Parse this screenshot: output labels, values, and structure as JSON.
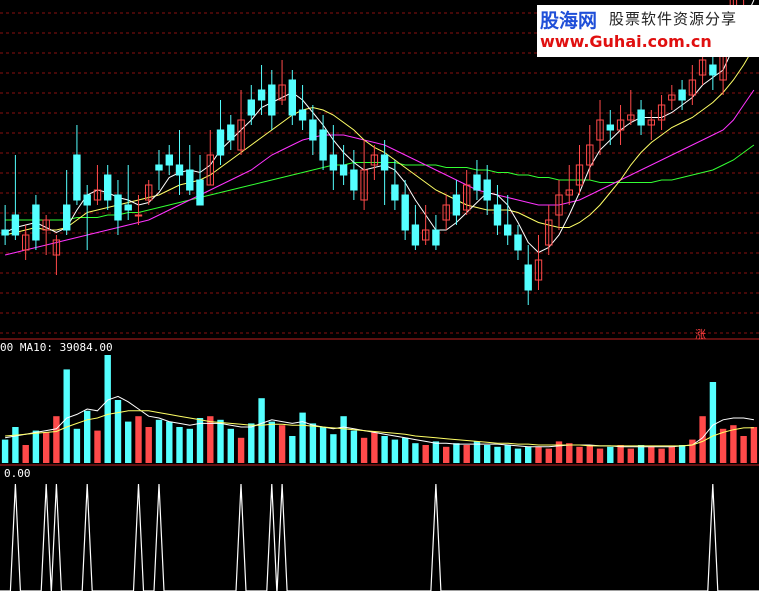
{
  "watermark": {
    "logo": "股海网",
    "tagline": "股票软件资源分享",
    "url": "www.Guhai.com.cn"
  },
  "badge": "涨",
  "volume_label_prefix": "00",
  "volume_label": "MA10: 39084.00",
  "signal_label": "0.00",
  "colors": {
    "background": "#000000",
    "up": "#ff4a4a",
    "down": "#54ffff",
    "grid": "#8a1010",
    "ma5": "#ffffff",
    "ma10": "#ffff66",
    "ma20": "#ff33ff",
    "ma60": "#33ff33",
    "separator": "#c02020",
    "signal": "#ffffff"
  },
  "chart_data": [
    {
      "type": "candlestick",
      "panel": "price",
      "ylim": [
        0,
        100
      ],
      "series": [
        {
          "name": "candles",
          "values": [
            [
              30,
              28,
              40,
              24
            ],
            [
              36,
              28,
              60,
              26
            ],
            [
              22,
              28,
              32,
              18
            ],
            [
              40,
              26,
              44,
              22
            ],
            [
              30,
              34,
              36,
              20
            ],
            [
              20,
              26,
              28,
              12
            ],
            [
              40,
              30,
              54,
              28
            ],
            [
              60,
              42,
              72,
              40
            ],
            [
              44,
              40,
              48,
              22
            ],
            [
              42,
              46,
              56,
              40
            ],
            [
              52,
              42,
              56,
              38
            ],
            [
              44,
              34,
              50,
              28
            ],
            [
              40,
              38,
              56,
              34
            ],
            [
              36,
              36,
              44,
              32
            ],
            [
              42,
              48,
              50,
              40
            ],
            [
              56,
              54,
              62,
              46
            ],
            [
              60,
              56,
              64,
              52
            ],
            [
              56,
              52,
              70,
              44
            ],
            [
              54,
              46,
              64,
              44
            ],
            [
              50,
              40,
              60,
              40
            ],
            [
              48,
              60,
              70,
              48
            ],
            [
              70,
              60,
              82,
              56
            ],
            [
              72,
              66,
              76,
              62
            ],
            [
              62,
              74,
              86,
              60
            ],
            [
              82,
              76,
              88,
              72
            ],
            [
              86,
              82,
              96,
              76
            ],
            [
              88,
              76,
              94,
              70
            ],
            [
              82,
              88,
              98,
              80
            ],
            [
              90,
              76,
              94,
              72
            ],
            [
              78,
              74,
              88,
              70
            ],
            [
              74,
              66,
              80,
              60
            ],
            [
              70,
              58,
              76,
              54
            ],
            [
              60,
              54,
              72,
              46
            ],
            [
              56,
              52,
              64,
              48
            ],
            [
              54,
              46,
              62,
              42
            ],
            [
              42,
              54,
              66,
              38
            ],
            [
              56,
              60,
              64,
              50
            ],
            [
              60,
              54,
              66,
              40
            ],
            [
              48,
              42,
              58,
              38
            ],
            [
              44,
              30,
              50,
              26
            ],
            [
              32,
              24,
              40,
              22
            ],
            [
              26,
              30,
              40,
              24
            ],
            [
              30,
              24,
              36,
              22
            ],
            [
              34,
              40,
              44,
              30
            ],
            [
              44,
              36,
              50,
              32
            ],
            [
              38,
              48,
              54,
              36
            ],
            [
              52,
              46,
              58,
              42
            ],
            [
              50,
              42,
              56,
              36
            ],
            [
              40,
              32,
              48,
              28
            ],
            [
              32,
              28,
              44,
              24
            ],
            [
              28,
              22,
              32,
              18
            ],
            [
              16,
              6,
              24,
              0
            ],
            [
              10,
              18,
              28,
              6
            ],
            [
              24,
              34,
              40,
              20
            ],
            [
              36,
              44,
              50,
              30
            ],
            [
              44,
              46,
              56,
              40
            ],
            [
              48,
              56,
              64,
              44
            ],
            [
              56,
              64,
              72,
              50
            ],
            [
              66,
              74,
              82,
              60
            ],
            [
              72,
              70,
              78,
              64
            ],
            [
              70,
              74,
              80,
              64
            ],
            [
              74,
              76,
              86,
              72
            ],
            [
              78,
              72,
              82,
              68
            ],
            [
              72,
              74,
              78,
              66
            ],
            [
              74,
              80,
              84,
              70
            ],
            [
              82,
              84,
              88,
              78
            ],
            [
              86,
              82,
              90,
              78
            ],
            [
              84,
              90,
              96,
              80
            ],
            [
              92,
              98,
              104,
              88
            ],
            [
              96,
              92,
              102,
              86
            ],
            [
              90,
              108,
              116,
              84
            ],
            [
              112,
              124,
              132,
              108
            ],
            [
              126,
              130,
              140,
              120
            ],
            [
              132,
              138,
              146,
              128
            ]
          ]
        },
        {
          "name": "MA5",
          "values": [
            29,
            31,
            32,
            33,
            31,
            29,
            31,
            38,
            44,
            46,
            45,
            43,
            42,
            40,
            41,
            45,
            51,
            53,
            54,
            53,
            56,
            62,
            66,
            70,
            74,
            79,
            81,
            83,
            85,
            82,
            77,
            72,
            66,
            61,
            57,
            54,
            55,
            56,
            54,
            49,
            42,
            36,
            30,
            30,
            33,
            37,
            41,
            45,
            44,
            40,
            33,
            25,
            21,
            23,
            28,
            36,
            45,
            55,
            62,
            66,
            70,
            73,
            75,
            75,
            75,
            77,
            80,
            83,
            88,
            91,
            94,
            103,
            113,
            122
          ]
        },
        {
          "name": "MA10",
          "values": [
            28,
            29,
            30,
            31,
            30,
            30,
            31,
            34,
            37,
            38,
            39,
            40,
            41,
            42,
            43,
            44,
            46,
            48,
            49,
            50,
            52,
            55,
            58,
            61,
            64,
            67,
            70,
            73,
            76,
            78,
            79,
            78,
            76,
            73,
            70,
            66,
            63,
            61,
            58,
            55,
            52,
            49,
            46,
            44,
            42,
            40,
            39,
            38,
            38,
            38,
            37,
            35,
            33,
            32,
            31,
            31,
            33,
            36,
            40,
            45,
            50,
            56,
            61,
            65,
            68,
            71,
            73,
            75,
            78,
            81,
            85,
            90,
            96,
            103
          ]
        },
        {
          "name": "MA20",
          "values": [
            20,
            21,
            22,
            23,
            24,
            25,
            26,
            27,
            28,
            29,
            30,
            31,
            32,
            33,
            34,
            36,
            38,
            40,
            42,
            44,
            46,
            48,
            50,
            52,
            54,
            57,
            60,
            62,
            64,
            66,
            67,
            68,
            68,
            68,
            67,
            66,
            65,
            64,
            62,
            60,
            58,
            56,
            54,
            52,
            50,
            48,
            46,
            45,
            44,
            43,
            42,
            41,
            40,
            40,
            40,
            41,
            42,
            44,
            46,
            48,
            50,
            52,
            54,
            56,
            58,
            60,
            62,
            64,
            66,
            68,
            70,
            74,
            80,
            86
          ]
        },
        {
          "name": "MA60",
          "values": [
            34,
            34,
            34,
            34,
            34,
            34,
            34,
            35,
            35,
            35,
            36,
            36,
            37,
            37,
            38,
            39,
            40,
            41,
            42,
            43,
            44,
            45,
            46,
            47,
            48,
            49,
            50,
            51,
            52,
            53,
            54,
            55,
            56,
            56,
            57,
            57,
            57,
            57,
            57,
            56,
            56,
            56,
            56,
            55,
            55,
            55,
            54,
            54,
            53,
            53,
            52,
            52,
            51,
            51,
            50,
            50,
            50,
            50,
            49,
            49,
            49,
            49,
            49,
            49,
            50,
            50,
            51,
            52,
            53,
            54,
            56,
            58,
            61,
            64
          ]
        }
      ]
    },
    {
      "type": "bar",
      "panel": "volume",
      "ylim": [
        0,
        120000
      ],
      "series": [
        {
          "name": "volume",
          "values": [
            26000,
            40000,
            20000,
            36000,
            34000,
            52000,
            104000,
            38000,
            58000,
            36000,
            120000,
            70000,
            46000,
            52000,
            40000,
            48000,
            46000,
            40000,
            38000,
            50000,
            52000,
            48000,
            38000,
            28000,
            44000,
            72000,
            46000,
            42000,
            30000,
            56000,
            44000,
            40000,
            32000,
            52000,
            36000,
            28000,
            34000,
            30000,
            26000,
            28000,
            22000,
            20000,
            24000,
            18000,
            22000,
            20000,
            24000,
            20000,
            18000,
            20000,
            16000,
            18000,
            18000,
            16000,
            24000,
            22000,
            18000,
            20000,
            16000,
            18000,
            20000,
            16000,
            20000,
            18000,
            16000,
            18000,
            20000,
            26000,
            52000,
            90000,
            38000,
            42000,
            30000,
            40000
          ]
        },
        {
          "name": "MA5",
          "values": [
            28000,
            30000,
            32000,
            34000,
            36000,
            38000,
            50000,
            54000,
            60000,
            58000,
            70000,
            74000,
            68000,
            60000,
            52000,
            50000,
            46000,
            44000,
            42000,
            44000,
            44000,
            44000,
            42000,
            40000,
            40000,
            44000,
            48000,
            46000,
            44000,
            46000,
            42000,
            40000,
            38000,
            40000,
            38000,
            36000,
            34000,
            32000,
            30000,
            28000,
            26000,
            24000,
            22000,
            22000,
            21000,
            21000,
            21000,
            21000,
            21000,
            20000,
            19000,
            18000,
            18000,
            18000,
            19000,
            20000,
            20000,
            20000,
            19000,
            19000,
            18000,
            18000,
            18000,
            18000,
            18000,
            18000,
            19000,
            20000,
            28000,
            42000,
            48000,
            50000,
            50000,
            48000
          ]
        },
        {
          "name": "MA10",
          "values": [
            30000,
            31000,
            32000,
            33000,
            34000,
            35000,
            40000,
            44000,
            48000,
            50000,
            54000,
            56000,
            58000,
            58000,
            58000,
            56000,
            54000,
            52000,
            50000,
            48000,
            46000,
            45000,
            44000,
            43000,
            42000,
            42000,
            43000,
            43000,
            42000,
            42000,
            41000,
            40000,
            39000,
            38000,
            37000,
            36000,
            35000,
            34000,
            33000,
            32000,
            30000,
            29000,
            28000,
            27000,
            26000,
            25000,
            24000,
            23000,
            22000,
            22000,
            21000,
            21000,
            20000,
            20000,
            20000,
            20000,
            20000,
            19000,
            19000,
            19000,
            19000,
            19000,
            19000,
            19000,
            19000,
            19000,
            19000,
            20000,
            24000,
            30000,
            34000,
            37000,
            39000,
            39084
          ]
        }
      ]
    },
    {
      "type": "line",
      "panel": "signal",
      "ylim": [
        0,
        1
      ],
      "series": [
        {
          "name": "signal",
          "values": [
            0,
            1,
            0,
            0,
            1,
            1,
            0,
            0,
            1,
            0,
            0,
            0,
            0,
            1,
            0,
            1,
            0,
            0,
            0,
            0,
            0,
            0,
            0,
            1,
            0,
            0,
            1,
            1,
            0,
            0,
            0,
            0,
            0,
            0,
            0,
            0,
            0,
            0,
            0,
            0,
            0,
            0,
            1,
            0,
            0,
            0,
            0,
            0,
            0,
            0,
            0,
            0,
            0,
            0,
            0,
            0,
            0,
            0,
            0,
            0,
            0,
            0,
            0,
            0,
            0,
            0,
            0,
            0,
            0,
            1,
            0,
            0,
            0,
            0
          ]
        }
      ]
    }
  ]
}
